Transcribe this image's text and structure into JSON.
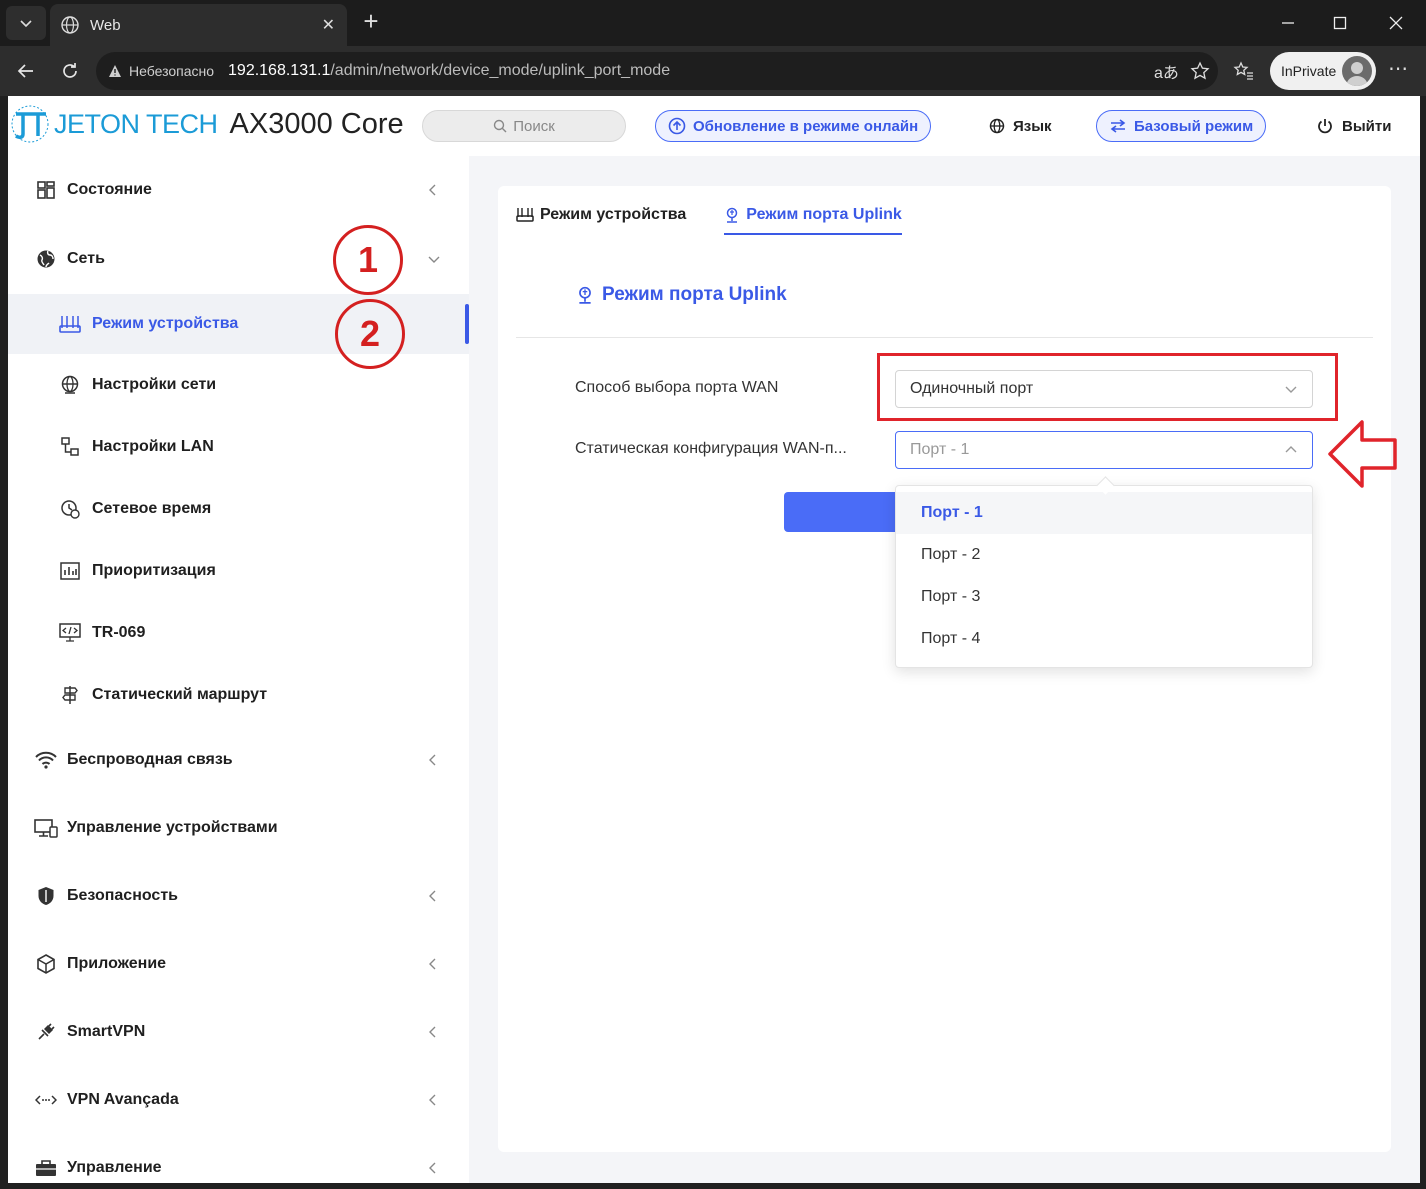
{
  "browser": {
    "tab_title": "Web",
    "address_warning": "Небезопасно",
    "address_host": "192.168.131.1",
    "address_path": "/admin/network/device_mode/uplink_port_mode",
    "inprivate_label": "InPrivate"
  },
  "header": {
    "brand": "JETON TECH",
    "model": "AX3000 Core",
    "search_placeholder": "Поиск",
    "online_update": "Обновление в режиме онлайн",
    "language": "Язык",
    "basic_mode": "Базовый режим",
    "logout": "Выйти"
  },
  "sidebar": {
    "items": [
      {
        "label": "Состояние",
        "icon": "dashboard-icon"
      },
      {
        "label": "Сеть",
        "icon": "network-globe-icon"
      },
      {
        "label": "Режим устройства",
        "icon": "router-icon"
      },
      {
        "label": "Настройки сети",
        "icon": "globe-icon"
      },
      {
        "label": "Настройки LAN",
        "icon": "lan-icon"
      },
      {
        "label": "Сетевое время",
        "icon": "clock-icon"
      },
      {
        "label": "Приоритизация",
        "icon": "chart-icon"
      },
      {
        "label": "TR-069",
        "icon": "code-monitor-icon"
      },
      {
        "label": "Статический маршрут",
        "icon": "signpost-icon"
      },
      {
        "label": "Беспроводная связь",
        "icon": "wifi-icon"
      },
      {
        "label": "Управление устройствами",
        "icon": "devices-icon"
      },
      {
        "label": "Безопасность",
        "icon": "shield-icon"
      },
      {
        "label": "Приложение",
        "icon": "cube-icon"
      },
      {
        "label": "SmartVPN",
        "icon": "plug-icon"
      },
      {
        "label": "VPN Avançada",
        "icon": "code-arrows-icon"
      },
      {
        "label": "Управление",
        "icon": "toolbox-icon"
      }
    ]
  },
  "content": {
    "tabs": [
      {
        "label": "Режим устройства",
        "icon": "router-icon"
      },
      {
        "label": "Режим порта Uplink",
        "icon": "uplink-icon"
      }
    ],
    "section_title": "Режим порта Uplink",
    "wan_select_label": "Способ выбора порта WAN",
    "wan_select_value": "Одиночный порт",
    "static_config_label": "Статическая конфигурация WAN-п...",
    "static_config_value": "Порт - 1",
    "port_options": [
      "Порт - 1",
      "Порт - 2",
      "Порт - 3",
      "Порт - 4"
    ],
    "selected_option_index": 0
  },
  "annotations": {
    "step1": "1",
    "step2": "2",
    "color": "#d42020"
  },
  "colors": {
    "accent": "#3a59e6",
    "brand": "#1b9bd7"
  }
}
